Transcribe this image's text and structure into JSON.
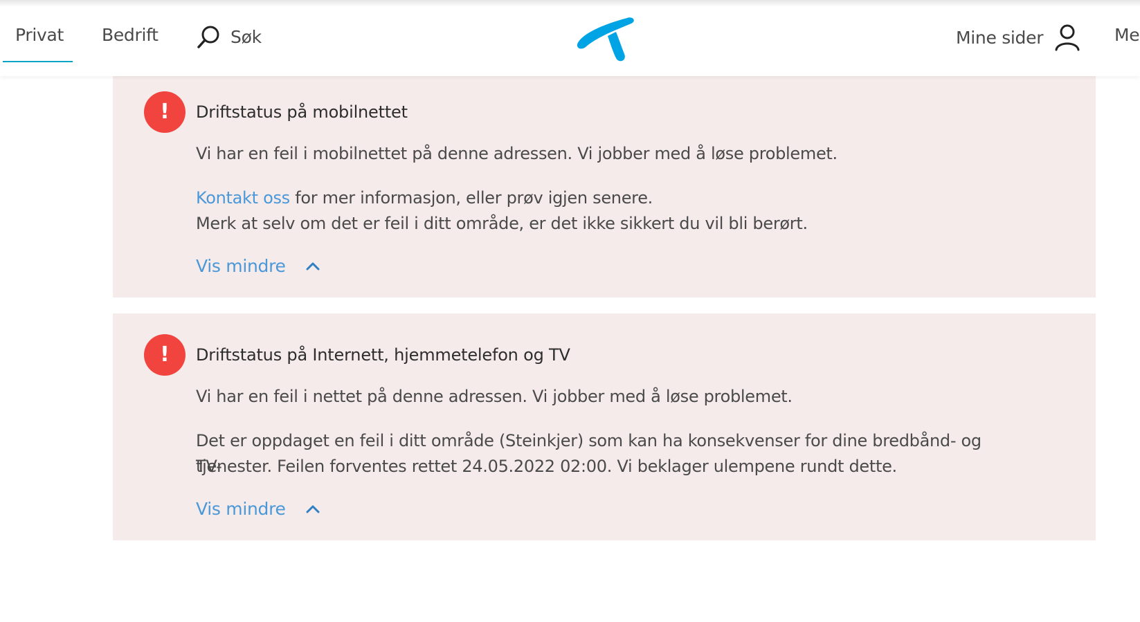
{
  "header": {
    "nav": {
      "privat": "Privat",
      "bedrift": "Bedrift",
      "search": "Søk",
      "mine_sider": "Mine sider",
      "meny": "Meny"
    },
    "brand_color": "#00a4c4"
  },
  "alerts": [
    {
      "title": "Driftstatus på mobilnettet",
      "message": "Vi har en feil i mobilnettet på denne adressen. Vi jobber med å løse problemet.",
      "contact_link": "Kontakt oss",
      "contact_rest": " for mer informasjon, eller prøv igjen senere.",
      "note": "Merk at selv om det er feil i ditt område, er det ikke sikkert du vil bli berørt.",
      "toggle_label": "Vis mindre"
    },
    {
      "title": "Driftstatus på Internett, hjemmetelefon og TV",
      "message": "Vi har en feil i nettet på denne adressen. Vi jobber med å løse problemet.",
      "detail_line1": "Det er oppdaget en feil i ditt område (Steinkjer) som kan ha konsekvenser for dine bredbånd- og TV-",
      "detail_line2": "tjenester. Feilen forventes rettet 24.05.2022 02:00. Vi beklager ulempene rundt dette.",
      "toggle_label": "Vis mindre"
    }
  ],
  "icons": {
    "warning": "!",
    "search": "search-icon",
    "user": "user-icon",
    "chevron": "chevron-up-icon",
    "logo": "telenor-logo-icon"
  },
  "colors": {
    "alert_bg": "#f6ebeb",
    "warning_red": "#f2443f",
    "link_blue": "#4a98d8"
  }
}
